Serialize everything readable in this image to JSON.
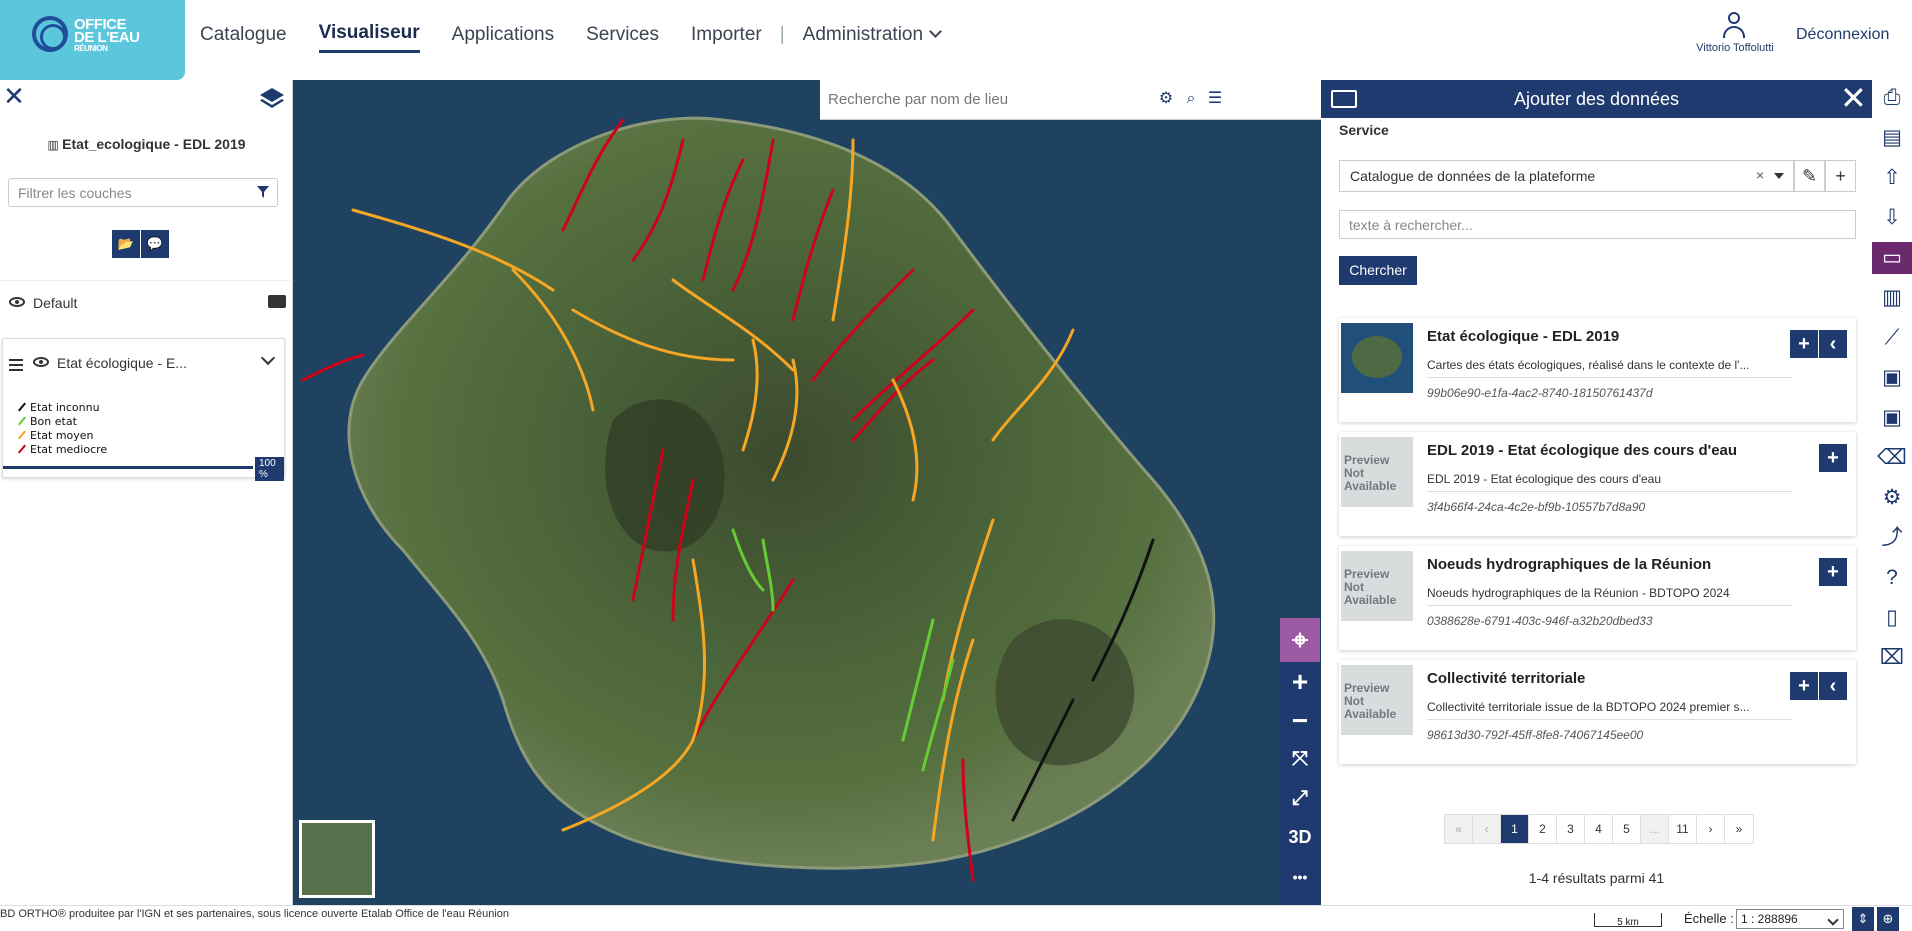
{
  "logo": {
    "line1": "OFFICE",
    "line2": "DE L'EAU",
    "line3": "RÉUNION"
  },
  "nav": {
    "items": [
      "Catalogue",
      "Visualiseur",
      "Applications",
      "Services",
      "Importer"
    ],
    "active": "Visualiseur",
    "separator": "|",
    "admin": "Administration"
  },
  "user": {
    "name": "Vittorio Toffolutti",
    "logout": "Déconnexion"
  },
  "left_panel": {
    "map_title": "Etat_ecologique - EDL 2019",
    "filter_placeholder": "Filtrer les couches",
    "group_name": "Default",
    "layer_name": "Etat écologique - E...",
    "legend": [
      {
        "label": "Etat inconnu",
        "color": "#111111"
      },
      {
        "label": "Bon etat",
        "color": "#66cc33"
      },
      {
        "label": "Etat moyen",
        "color": "#f5a623"
      },
      {
        "label": "Etat mediocre",
        "color": "#d0021b"
      }
    ],
    "opacity": "100 %"
  },
  "map": {
    "search_placeholder": "Recherche par nom de lieu",
    "controls": [
      "locate-icon",
      "zoom-in-icon",
      "zoom-out-icon",
      "fit-extent-icon",
      "fullscreen-icon",
      "3D",
      "more-icon"
    ],
    "label_3d": "3D",
    "more": "•••"
  },
  "add_data": {
    "title": "Ajouter des données",
    "service_label": "Service",
    "service_value": "Catalogue de données de la plateforme",
    "clear": "×",
    "search_placeholder": "texte à rechercher...",
    "search_button": "Chercher",
    "results": [
      {
        "title": "Etat écologique - EDL 2019",
        "description": "Cartes des états écologiques, réalisé dans le contexte de l'...",
        "id": "99b06e90-e1fa-4ac2-8740-18150761437d",
        "thumb": "island",
        "collapse": true
      },
      {
        "title": "EDL 2019 - Etat écologique des cours d'eau",
        "description": "EDL 2019 - Etat écologique des cours d'eau",
        "id": "3f4b66f4-24ca-4c2e-bf9b-10557b7d8a90",
        "thumb": "Preview Not Available",
        "collapse": false
      },
      {
        "title": "Noeuds hydrographiques de la Réunion",
        "description": "Noeuds hydrographiques de la Réunion - BDTOPO 2024",
        "id": "0388628e-6791-403c-946f-a32b20dbed33",
        "thumb": "Preview Not Available",
        "collapse": false
      },
      {
        "title": "Collectivité territoriale",
        "description": "Collectivité territoriale issue de la BDTOPO 2024 premier s...",
        "id": "98613d30-792f-45ff-8fe8-74067145ee00",
        "thumb": "Preview Not Available",
        "collapse": true
      }
    ],
    "pagination": [
      "«",
      "‹",
      "1",
      "2",
      "3",
      "4",
      "5",
      "...",
      "11",
      "›",
      "»"
    ],
    "active_page": "1",
    "result_count": "1-4 résultats parmi 41"
  },
  "toolbar": [
    "print-icon",
    "document-icon",
    "upload-icon",
    "download-icon",
    "open-folder-icon",
    "catalog-icon",
    "measure-icon",
    "save-icon",
    "save-as-icon",
    "delete-icon",
    "settings-icon",
    "share-icon",
    "help-icon",
    "book-icon",
    "trash-icon"
  ],
  "footer": {
    "attribution": "BD ORTHO® produitee par l'IGN et ses partenaires, sous licence ouverte Etalab",
    "attribution_link": "Office de l'eau Réunion",
    "scale_bar": "5 km",
    "scale_label": "Échelle :",
    "scale_value": "1 : 288896"
  },
  "colors": {
    "primary": "#1e3a6e",
    "accent": "#6a2a6d",
    "logo_bg": "#5cc6dc"
  }
}
